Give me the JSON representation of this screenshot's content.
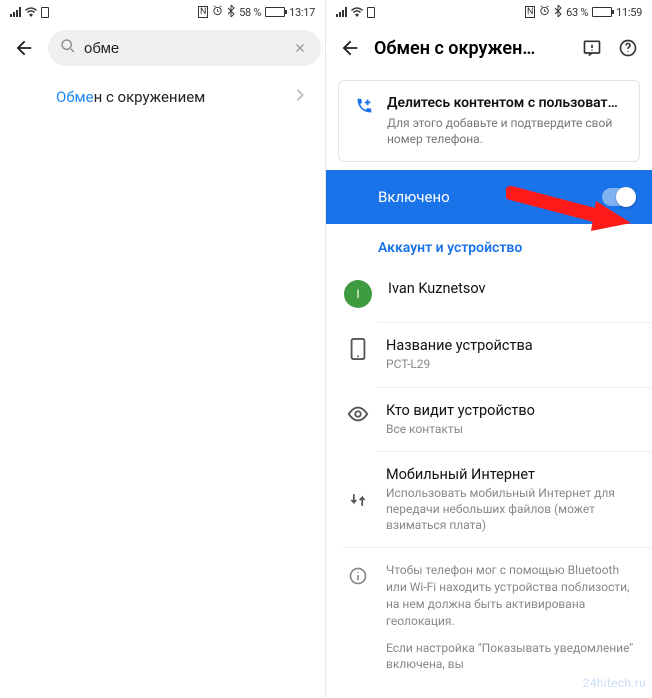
{
  "left": {
    "status": {
      "battery_pct": "58 %",
      "time": "13:17",
      "nfc": "N",
      "alarm": true,
      "bt": true
    },
    "search": {
      "value": "обме"
    },
    "result": {
      "highlight": "Обме",
      "rest": "н с окружением"
    }
  },
  "right": {
    "status": {
      "battery_pct": "63 %",
      "time": "11:59",
      "nfc": "N",
      "alarm": true,
      "bt": true
    },
    "title": "Обмен с окружен…",
    "notice": {
      "title": "Делитесь контентом с пользоват…",
      "body": "Для этого добавьте и подтвердите свой номер телефона."
    },
    "toggle": {
      "label": "Включено",
      "on": true
    },
    "section_header": "Аккаунт и устройство",
    "account": {
      "initial": "I",
      "name": "Ivan Kuznetsov"
    },
    "device_name": {
      "label": "Название устройства",
      "value": "PCT-L29"
    },
    "visibility": {
      "label": "Кто видит устройство",
      "value": "Все контакты"
    },
    "mobile_data": {
      "label": "Мобильный Интернет",
      "desc": "Использовать мобильный Интернет для передачи небольших файлов (может взиматься плата)"
    },
    "info1": "Чтобы телефон мог с помощью Bluetooth или Wi-Fi находить устройства поблизости, на нем должна быть активирована геолокация.",
    "info2": "Если настройка \"Показывать уведомление\" включена, вы"
  },
  "watermark": "24hitech.ru"
}
